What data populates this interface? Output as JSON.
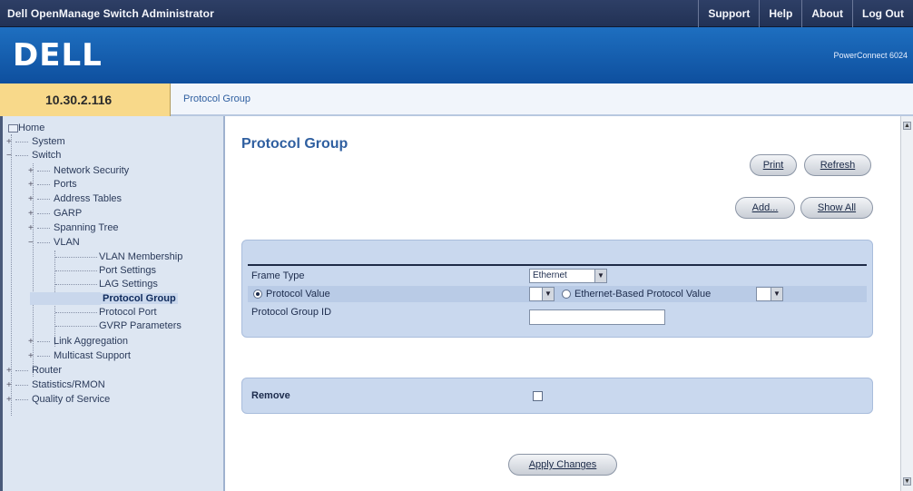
{
  "header": {
    "app_title": "Dell OpenManage Switch Administrator",
    "nav": [
      "Support",
      "Help",
      "About",
      "Log Out"
    ],
    "brand": "DELL",
    "model": "PowerConnect 6024"
  },
  "address": {
    "ip": "10.30.2.116",
    "breadcrumb": "Protocol Group"
  },
  "sidebar": {
    "items": [
      {
        "label": "Home"
      },
      {
        "label": "System"
      },
      {
        "label": "Switch"
      },
      {
        "label": "Network Security"
      },
      {
        "label": "Ports"
      },
      {
        "label": "Address Tables"
      },
      {
        "label": "GARP"
      },
      {
        "label": "Spanning Tree"
      },
      {
        "label": "VLAN"
      },
      {
        "label": "VLAN Membership"
      },
      {
        "label": "Port Settings"
      },
      {
        "label": "LAG Settings"
      },
      {
        "label": "Protocol Group"
      },
      {
        "label": "Protocol Port"
      },
      {
        "label": "GVRP Parameters"
      },
      {
        "label": "Link Aggregation"
      },
      {
        "label": "Multicast Support"
      },
      {
        "label": "Router"
      },
      {
        "label": "Statistics/RMON"
      },
      {
        "label": "Quality of Service"
      }
    ],
    "selected": "Protocol Group"
  },
  "main": {
    "title": "Protocol Group",
    "buttons": {
      "print": "Print",
      "refresh": "Refresh",
      "add": "Add...",
      "show_all": "Show All",
      "apply": "Apply Changes"
    },
    "form": {
      "frame_type_label": "Frame Type",
      "frame_type_value": "Ethernet",
      "protocol_value_label": "Protocol Value",
      "protocol_value_value": "",
      "ethernet_based_label": "Ethernet-Based Protocol Value",
      "ethernet_based_value": "",
      "group_id_label": "Protocol Group ID",
      "group_id_value": "",
      "remove_label": "Remove"
    }
  }
}
